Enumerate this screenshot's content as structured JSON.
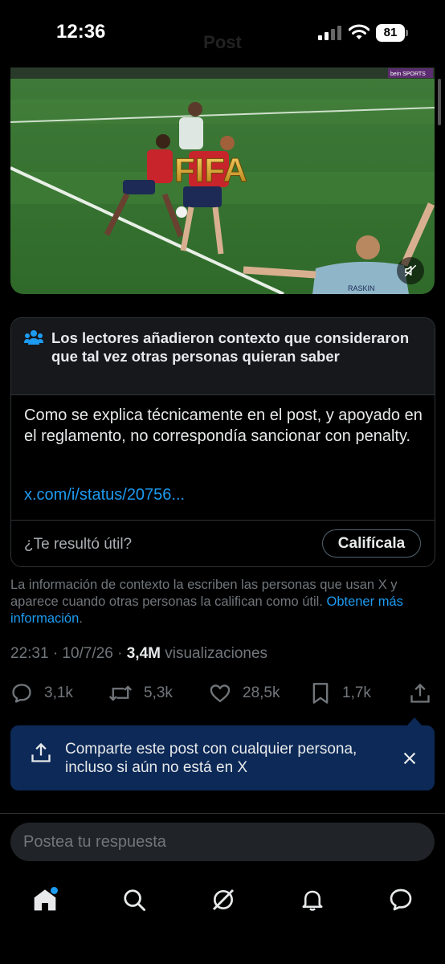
{
  "status_bar": {
    "time": "12:36",
    "battery": "81",
    "header_title": "Post"
  },
  "video": {
    "overlay_text": "FIFA",
    "broadcaster": "bein SPORTS",
    "jersey_name": "RASKIN"
  },
  "community_note": {
    "title": "Los lectores añadieron contexto que consideraron que tal vez otras personas quieran saber",
    "body": "Como se explica técnicamente en el post, y apoyado en el reglamento, no correspondía sancionar con penalty.",
    "link": "x.com/i/status/20756...",
    "question": "¿Te resultó útil?",
    "rate_label": "Califícala"
  },
  "context_info": {
    "text": "La información de contexto la escriben las personas que usan X y aparece cuando otras personas la califican como útil. ",
    "link": "Obtener más información",
    "suffix": "."
  },
  "meta": {
    "datetime": "22:31 · 10/7/26 · ",
    "views_count": "3,4M",
    "views_label": " visualizaciones"
  },
  "actions": {
    "replies": "3,1k",
    "reposts": "5,3k",
    "likes": "28,5k",
    "bookmarks": "1,7k"
  },
  "share_banner": {
    "text": "Comparte este post con cualquier persona, incluso si aún no está en X"
  },
  "reply": {
    "placeholder": "Postea tu respuesta"
  },
  "colors": {
    "accent": "#1d9bf0",
    "banner": "#0c2957",
    "background": "#000000"
  }
}
